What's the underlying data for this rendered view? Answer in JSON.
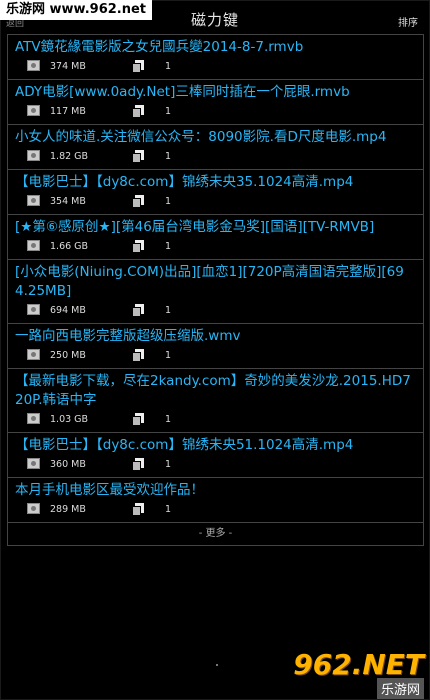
{
  "watermark": {
    "top_text": "乐游网 www.962.net",
    "logo_main": "962.NET",
    "logo_sub": "乐游网"
  },
  "header": {
    "back_label": "返回",
    "title": "磁力键",
    "sort_label": "排序"
  },
  "items": [
    {
      "name": "ATV鏡花緣電影版之女兒國兵變2014-8-7.rmvb",
      "size": "374 MB",
      "files": "1"
    },
    {
      "name": "ADY电影[www.0ady.Net]三棒同时插在一个屁眼.rmvb",
      "size": "117 MB",
      "files": "1"
    },
    {
      "name": "小女人的味道.关注微信公众号：8090影院.看D尺度电影.mp4",
      "size": "1.82 GB",
      "files": "1"
    },
    {
      "name": "【电影巴士】【dy8c.com】锦绣未央35.1024高清.mp4",
      "size": "354 MB",
      "files": "1"
    },
    {
      "name": "[★第⑥感原创★][第46届台湾电影金马奖][国语][TV-RMVB]",
      "size": "1.66 GB",
      "files": "1"
    },
    {
      "name": "[小众电影(Niuing.COM)出品][血恋1][720P高清国语完整版][694.25MB]",
      "size": "694 MB",
      "files": "1"
    },
    {
      "name": "一路向西电影完整版超级压缩版.wmv",
      "size": "250 MB",
      "files": "1"
    },
    {
      "name": "【最新电影下载，尽在2kandy.com】奇妙的美发沙龙.2015.HD720P.韩语中字",
      "size": "1.03 GB",
      "files": "1"
    },
    {
      "name": "【电影巴士】【dy8c.com】锦绣未央51.1024高清.mp4",
      "size": "360 MB",
      "files": "1"
    },
    {
      "name": "本月手机电影区最受欢迎作品！",
      "size": "289 MB",
      "files": "1"
    }
  ],
  "more_label": "- 更多 -",
  "colors": {
    "link": "#29b6f6",
    "background": "#000000",
    "divider": "#444444"
  }
}
